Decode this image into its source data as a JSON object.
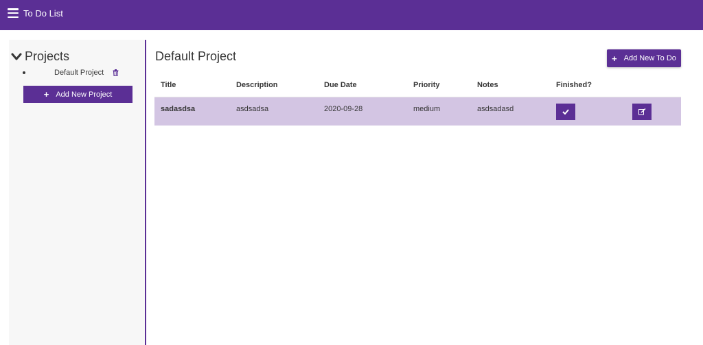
{
  "navbar": {
    "title": "To Do List",
    "bg_color": "#5b2f95"
  },
  "sidebar": {
    "title": "Projects",
    "toggle_icon": "chevron-down-icon",
    "projects": [
      {
        "label": "Default Project",
        "delete_icon": "trash-icon"
      }
    ],
    "add_project_label": "Add New Project"
  },
  "main": {
    "project_title": "Default Project",
    "add_todo_label": "Add New To Do",
    "table": {
      "columns": [
        "Title",
        "Description",
        "Due Date",
        "Priority",
        "Notes",
        "Finished?",
        ""
      ],
      "rows": [
        {
          "title": "sadasdsa",
          "description": "asdsadsa",
          "due_date": "2020-09-28",
          "priority": "medium",
          "notes": "asdsadasd",
          "finish_icon": "checkmark-icon",
          "edit_icon": "edit-icon"
        }
      ]
    }
  },
  "colors": {
    "accent": "#5b2f95",
    "row_highlight": "#d3c5e3",
    "sidebar_bg": "#f7f7f7"
  }
}
